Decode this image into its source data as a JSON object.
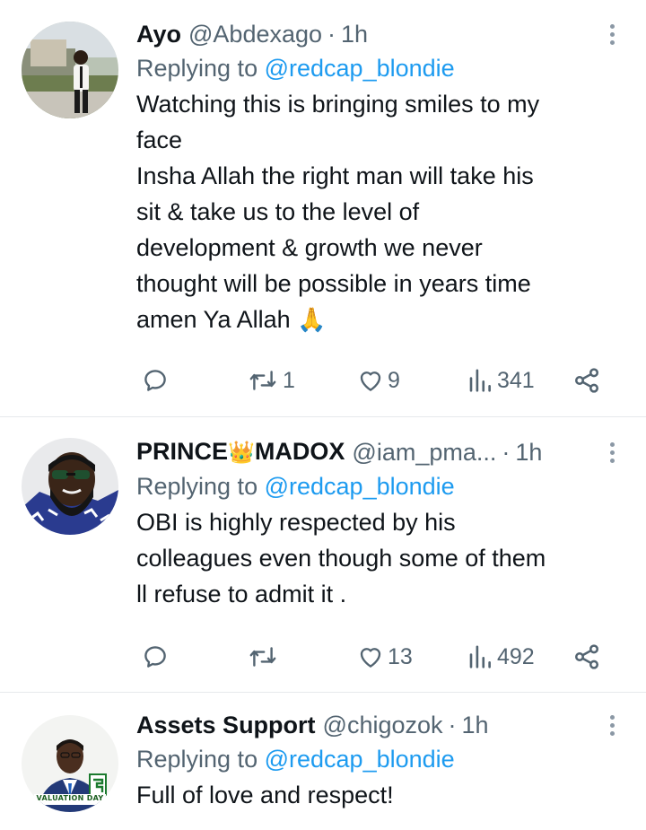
{
  "tweets": [
    {
      "name": "Ayo",
      "handle": "@Abdexago",
      "separator": "·",
      "time": "1h",
      "replying_prefix": "Replying to",
      "replying_to": "@redcap_blondie",
      "text": "Watching this is bringing smiles to my\nface\nInsha Allah the right man will take his\nsit & take us to the level of\ndevelopment & growth we never\nthought will be possible in years time\namen  Ya Allah ",
      "emoji": "🙏",
      "reply_count": "",
      "retweet_count": "1",
      "like_count": "9",
      "view_count": "341"
    },
    {
      "name_part1": "PRINCE",
      "name_emoji": "👑",
      "name_part2": "MADOX",
      "handle": "@iam_pma...",
      "separator": "·",
      "time": "1h",
      "replying_prefix": "Replying to",
      "replying_to": "@redcap_blondie",
      "text": "OBI is highly respected by his\ncolleagues even though some of them\nll refuse to admit it .",
      "reply_count": "",
      "retweet_count": "",
      "like_count": "13",
      "view_count": "492"
    },
    {
      "name": "Assets Support",
      "handle": "@chigozok",
      "separator": "·",
      "time": "1h",
      "replying_prefix": "Replying to",
      "replying_to": "@redcap_blondie",
      "text": "Full of love and respect!",
      "avatar_banner": "VALUATION DAY"
    }
  ],
  "icons": {
    "reply": "reply-icon",
    "retweet": "retweet-icon",
    "like": "heart-icon",
    "views": "analytics-icon",
    "share": "share-icon",
    "more": "more-icon"
  },
  "colors": {
    "text": "#0f1419",
    "secondary": "#536471",
    "link": "#1d9bf0",
    "divider": "#e6e9ec"
  }
}
